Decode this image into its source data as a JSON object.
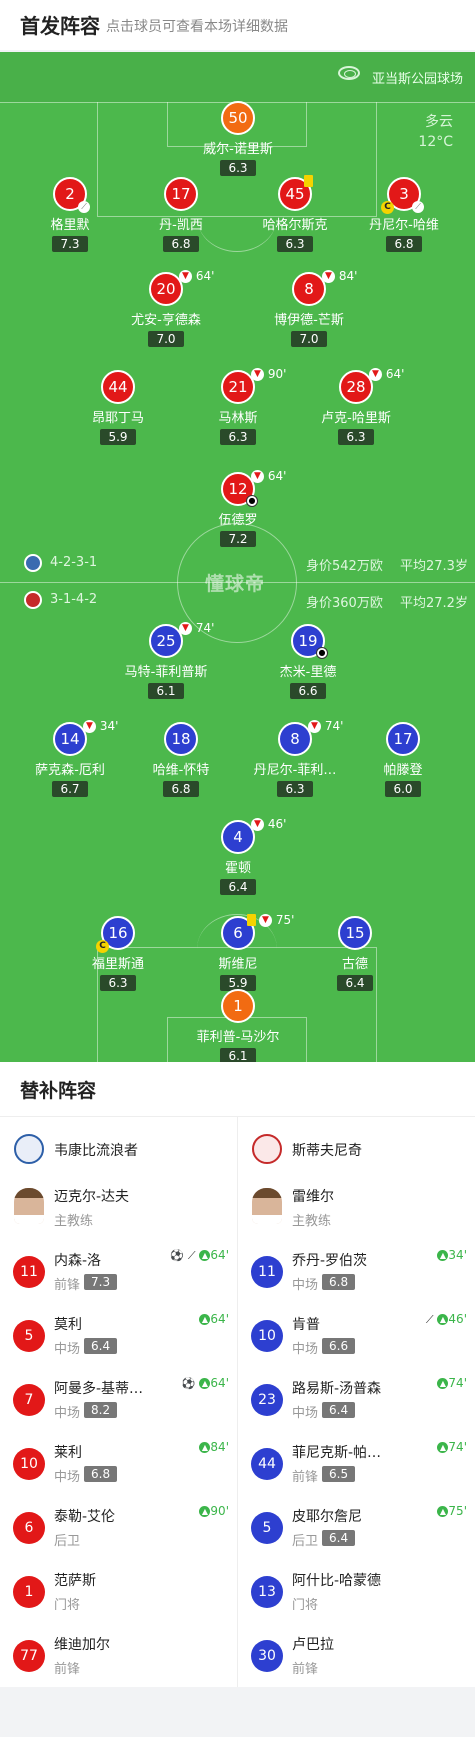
{
  "header": {
    "title": "首发阵容",
    "subtitle": "点击球员可查看本场详细数据"
  },
  "pitch": {
    "stadium": "亚当斯公园球场",
    "weather": "多云",
    "temperature": "12°C",
    "watermark": "懂球帝"
  },
  "home_team": {
    "formation": "4-2-3-1",
    "value": "身价542万欧",
    "age": "平均27.3岁",
    "color": "#e21818"
  },
  "away_team": {
    "formation": "3-1-4-2",
    "value": "身价360万欧",
    "age": "平均27.2岁",
    "color": "#2d3fd0"
  },
  "home_players": [
    {
      "num": "50",
      "name": "威尔-诺里斯",
      "rating": "6.3"
    },
    {
      "num": "2",
      "name": "格里默",
      "rating": "7.3"
    },
    {
      "num": "17",
      "name": "丹-凯西",
      "rating": "6.8"
    },
    {
      "num": "45",
      "name": "哈格尔斯克",
      "rating": "6.3"
    },
    {
      "num": "3",
      "name": "丹尼尔-哈维",
      "rating": "6.8"
    },
    {
      "num": "20",
      "name": "尤安-亨德森",
      "rating": "7.0",
      "sub": "64'"
    },
    {
      "num": "8",
      "name": "博伊德-芒斯",
      "rating": "7.0",
      "sub": "84'"
    },
    {
      "num": "44",
      "name": "昂耶丁马",
      "rating": "5.9"
    },
    {
      "num": "21",
      "name": "马林斯",
      "rating": "6.3",
      "sub": "90'"
    },
    {
      "num": "28",
      "name": "卢克-哈里斯",
      "rating": "6.3",
      "sub": "64'"
    },
    {
      "num": "12",
      "name": "伍德罗",
      "rating": "7.2",
      "sub": "64'"
    }
  ],
  "away_players": [
    {
      "num": "25",
      "name": "马特-菲利普斯",
      "rating": "6.1",
      "sub": "74'"
    },
    {
      "num": "19",
      "name": "杰米-里德",
      "rating": "6.6"
    },
    {
      "num": "14",
      "name": "萨克森-厄利",
      "rating": "6.7",
      "sub": "34'"
    },
    {
      "num": "18",
      "name": "哈维-怀特",
      "rating": "6.8"
    },
    {
      "num": "8",
      "name": "丹尼尔-菲利…",
      "rating": "6.3",
      "sub": "74'"
    },
    {
      "num": "17",
      "name": "帕滕登",
      "rating": "6.0"
    },
    {
      "num": "4",
      "name": "霍顿",
      "rating": "6.4",
      "sub": "46'"
    },
    {
      "num": "16",
      "name": "福里斯通",
      "rating": "6.3"
    },
    {
      "num": "6",
      "name": "斯维尼",
      "rating": "5.9",
      "sub": "75'"
    },
    {
      "num": "15",
      "name": "古德",
      "rating": "6.4"
    },
    {
      "num": "1",
      "name": "菲利普-马沙尔",
      "rating": "6.1"
    }
  ],
  "subs": {
    "title": "替补阵容",
    "home": {
      "team_name": "韦康比流浪者",
      "coach_name": "迈克尔-达夫",
      "coach_role": "主教练",
      "players": [
        {
          "num": "11",
          "name": "内森-洛",
          "pos": "前锋",
          "rating": "7.3",
          "in": "64'"
        },
        {
          "num": "5",
          "name": "莫利",
          "pos": "中场",
          "rating": "6.4",
          "in": "64'"
        },
        {
          "num": "7",
          "name": "阿曼多-基蒂…",
          "pos": "中场",
          "rating": "8.2",
          "in": "64'"
        },
        {
          "num": "10",
          "name": "莱利",
          "pos": "中场",
          "rating": "6.8",
          "in": "84'"
        },
        {
          "num": "6",
          "name": "泰勒-艾伦",
          "pos": "后卫",
          "rating": "",
          "in": "90'"
        },
        {
          "num": "1",
          "name": "范萨斯",
          "pos": "门将",
          "rating": "",
          "in": ""
        },
        {
          "num": "77",
          "name": "维迪加尔",
          "pos": "前锋",
          "rating": "",
          "in": ""
        }
      ]
    },
    "away": {
      "team_name": "斯蒂夫尼奇",
      "coach_name": "雷维尔",
      "coach_role": "主教练",
      "players": [
        {
          "num": "11",
          "name": "乔丹-罗伯茨",
          "pos": "中场",
          "rating": "6.8",
          "in": "34'"
        },
        {
          "num": "10",
          "name": "肯普",
          "pos": "中场",
          "rating": "6.6",
          "in": "46'"
        },
        {
          "num": "23",
          "name": "路易斯-汤普森",
          "pos": "中场",
          "rating": "6.4",
          "in": "74'"
        },
        {
          "num": "44",
          "name": "菲尼克斯-帕…",
          "pos": "前锋",
          "rating": "6.5",
          "in": "74'"
        },
        {
          "num": "5",
          "name": "皮耶尔詹尼",
          "pos": "后卫",
          "rating": "6.4",
          "in": "75'"
        },
        {
          "num": "13",
          "name": "阿什比-哈蒙德",
          "pos": "门将",
          "rating": "",
          "in": ""
        },
        {
          "num": "30",
          "name": "卢巴拉",
          "pos": "前锋",
          "rating": "",
          "in": ""
        }
      ]
    }
  }
}
